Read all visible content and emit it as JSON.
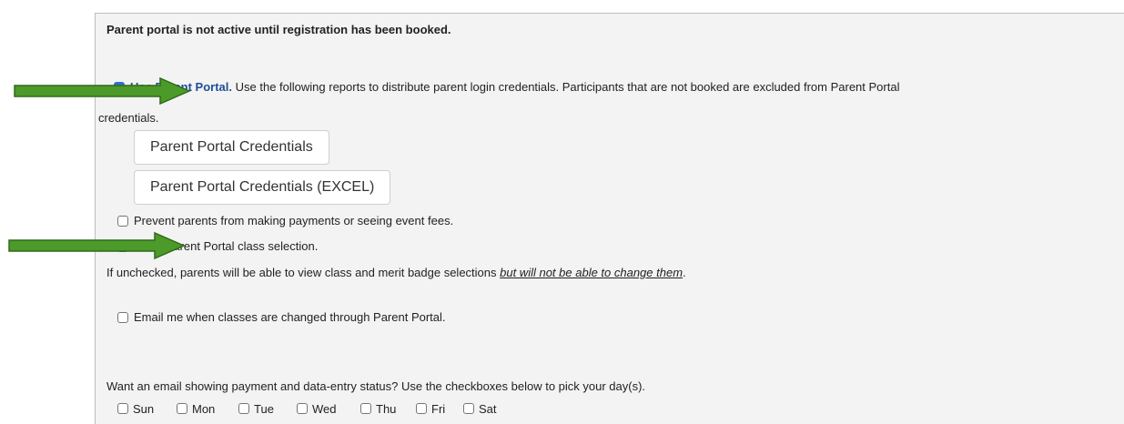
{
  "notice": "Parent portal is not active until registration has been booked.",
  "use_parent_portal": {
    "label": "Use Parent Portal.",
    "checked": true,
    "description_line1": "Use the following reports to distribute parent login credentials. Participants that are not booked are excluded from Parent Portal",
    "description_line2": "credentials."
  },
  "buttons": {
    "credentials": "Parent Portal Credentials",
    "credentials_excel": "Parent Portal Credentials (EXCEL)"
  },
  "prevent_payments": {
    "label": "Prevent parents from making payments or seeing event fees.",
    "checked": false
  },
  "allow_class_selection": {
    "label": "Allow Parent Portal class selection.",
    "checked": true
  },
  "unchecked_note": {
    "prefix": "If unchecked, parents will be able to view class and merit badge selections ",
    "emphasis": "but will not be able to change them",
    "suffix": "."
  },
  "email_on_change": {
    "label": "Email me when classes are changed through Parent Portal.",
    "checked": false
  },
  "email_status_prompt": "Want an email showing payment and data-entry status? Use the checkboxes below to pick your day(s).",
  "days": [
    {
      "label": "Sun",
      "checked": false
    },
    {
      "label": "Mon",
      "checked": false
    },
    {
      "label": "Tue",
      "checked": false
    },
    {
      "label": "Wed",
      "checked": false
    },
    {
      "label": "Thu",
      "checked": false
    },
    {
      "label": "Fri",
      "checked": false
    },
    {
      "label": "Sat",
      "checked": false
    }
  ],
  "colors": {
    "arrow": "#4c9a2a",
    "checkbox_checked": "#2d6fd6",
    "link_label": "#1e4d9a",
    "panel_bg": "#f3f3f3"
  },
  "icons": {
    "annotation_arrow": "right-arrow-icon"
  }
}
